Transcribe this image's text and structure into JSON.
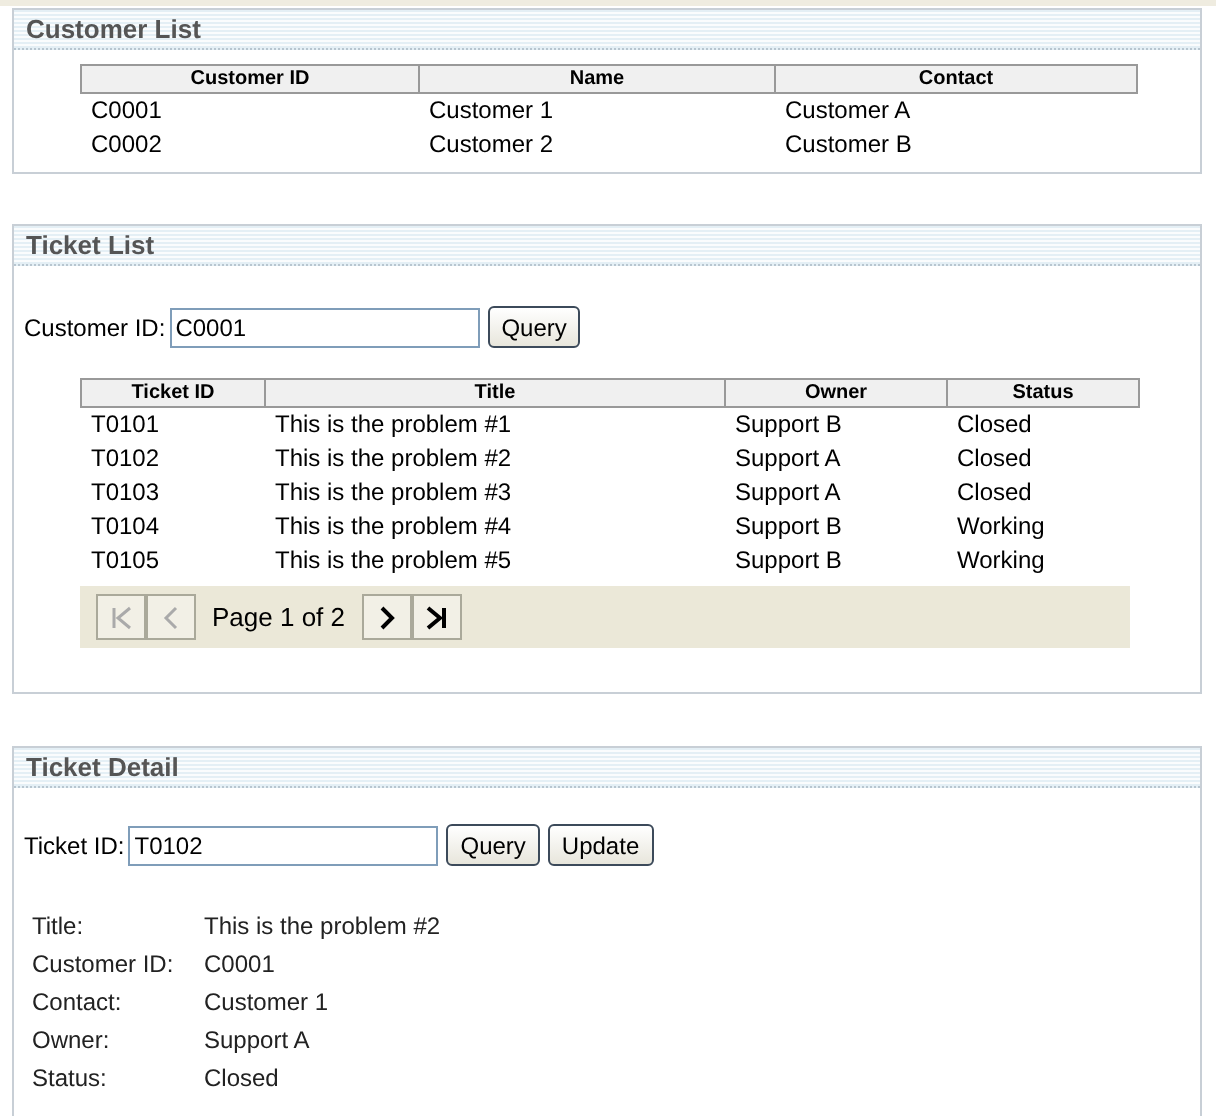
{
  "customer_list": {
    "title": "Customer List",
    "columns": [
      "Customer ID",
      "Name",
      "Contact"
    ],
    "rows": [
      [
        "C0001",
        "Customer 1",
        "Customer A"
      ],
      [
        "C0002",
        "Customer 2",
        "Customer B"
      ]
    ]
  },
  "ticket_list": {
    "title": "Ticket List",
    "field_label": "Customer ID:",
    "field_value": "C0001",
    "query_button": "Query",
    "columns": [
      "Ticket ID",
      "Title",
      "Owner",
      "Status"
    ],
    "rows": [
      [
        "T0101",
        "This is the problem #1",
        "Support B",
        "Closed"
      ],
      [
        "T0102",
        "This is the problem #2",
        "Support A",
        "Closed"
      ],
      [
        "T0103",
        "This is the problem #3",
        "Support A",
        "Closed"
      ],
      [
        "T0104",
        "This is the problem #4",
        "Support B",
        "Working"
      ],
      [
        "T0105",
        "This is the problem #5",
        "Support B",
        "Working"
      ]
    ],
    "pager": {
      "page_text": "Page 1 of 2",
      "buttons": [
        {
          "kind": "first",
          "disabled": true
        },
        {
          "kind": "prev",
          "disabled": true
        },
        {
          "kind": "next",
          "disabled": false
        },
        {
          "kind": "last",
          "disabled": false
        }
      ]
    }
  },
  "ticket_detail": {
    "title": "Ticket Detail",
    "field_label": "Ticket ID:",
    "field_value": "T0102",
    "buttons": [
      "Query",
      "Update"
    ],
    "fields": [
      {
        "label": "Title:",
        "value": "This is the problem #2"
      },
      {
        "label": "Customer ID:",
        "value": "C0001"
      },
      {
        "label": "Contact:",
        "value": "Customer 1"
      },
      {
        "label": "Owner:",
        "value": "Support A"
      },
      {
        "label": "Status:",
        "value": "Closed"
      }
    ]
  }
}
